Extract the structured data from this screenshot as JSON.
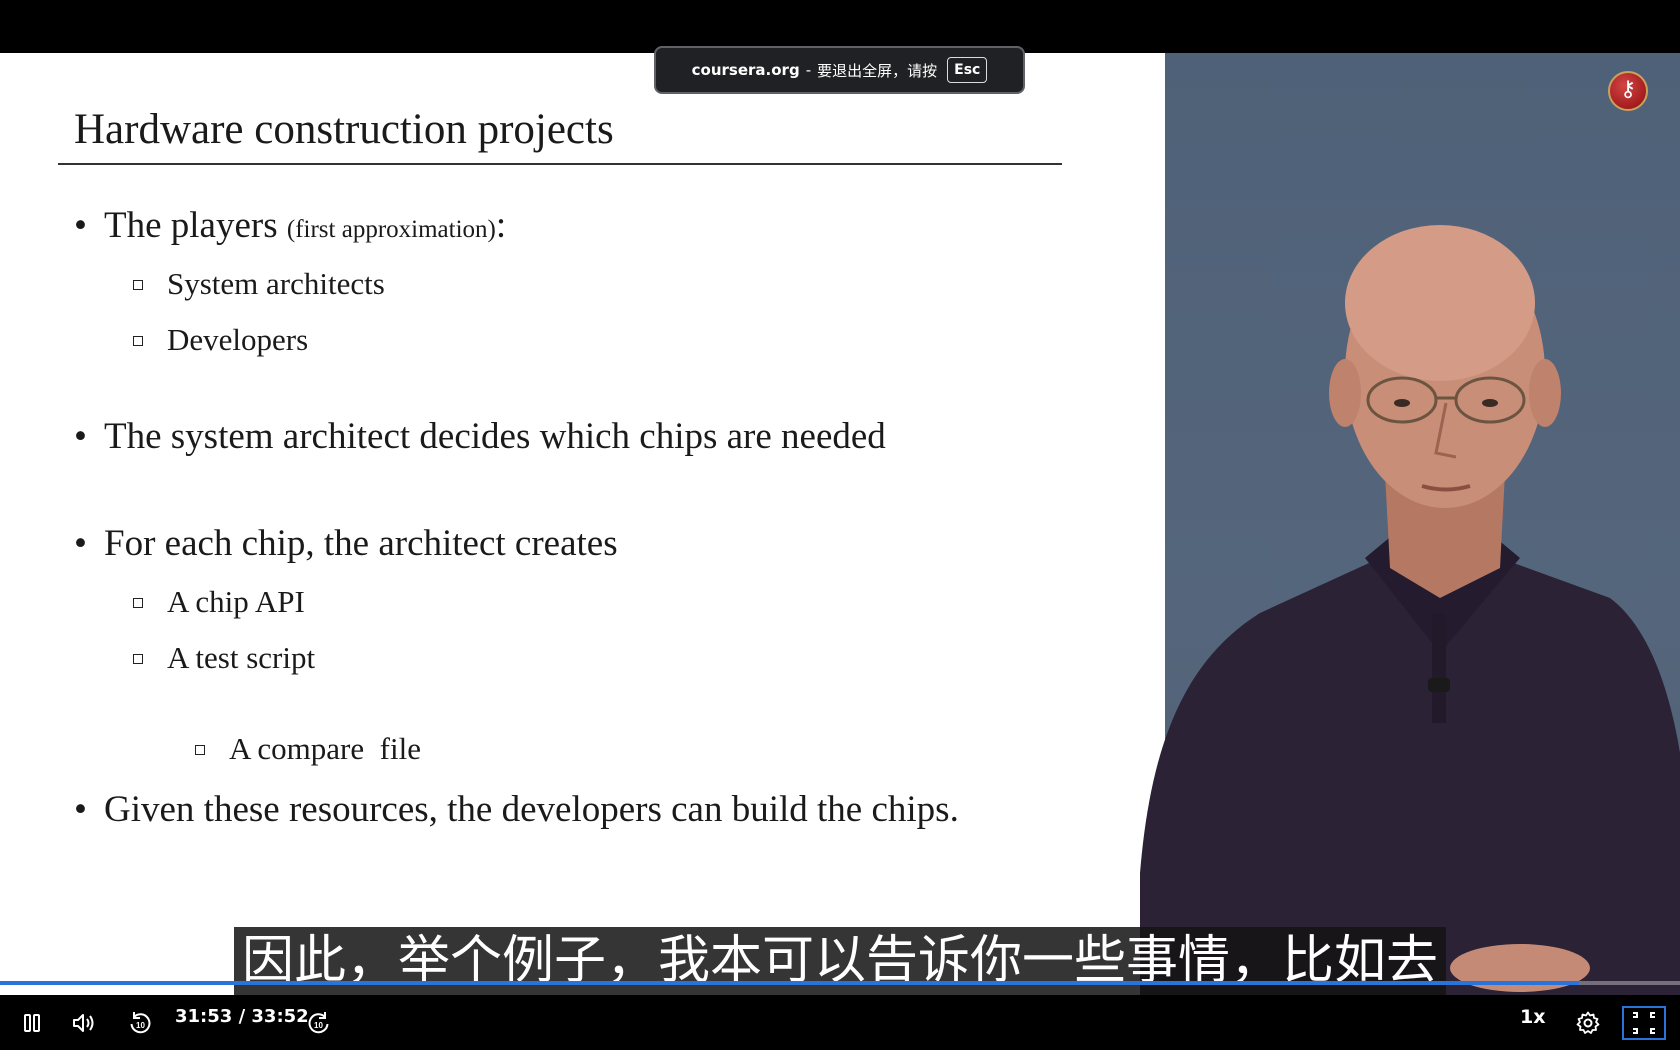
{
  "fullscreen_hint": {
    "domain": "coursera.org",
    "separator": "-",
    "message": "要退出全屏，请按",
    "key": "Esc"
  },
  "slide": {
    "title": "Hardware construction projects",
    "bullet_glyph": "•",
    "bullets": [
      {
        "text": "The players",
        "note": "(first approximation)",
        "suffix": ":"
      },
      {
        "text": "The system architect decides which chips are needed"
      },
      {
        "text": "For each chip, the architect creates"
      },
      {
        "text": "Given these resources, the developers can build the chips."
      }
    ],
    "sub_items_players": [
      "System architects",
      "Developers"
    ],
    "sub_items_chip": [
      "A chip API",
      "A test script",
      "A compare  file"
    ]
  },
  "caption": {
    "text": "因此，举个例子，我本可以告诉你一些事情，比如去"
  },
  "player": {
    "current_time": "31:53",
    "duration": "33:52",
    "time_display": "31:53 / 33:52",
    "progress_fraction": 0.94,
    "speed": "1x",
    "accent_color": "#2a73d9",
    "icons": {
      "pause": "pause-icon",
      "volume": "volume-icon",
      "rewind": "rewind-10-icon",
      "forward": "forward-10-icon",
      "settings": "gear-icon",
      "exit_fullscreen": "exit-fullscreen-icon"
    },
    "skip_seconds": "10"
  }
}
